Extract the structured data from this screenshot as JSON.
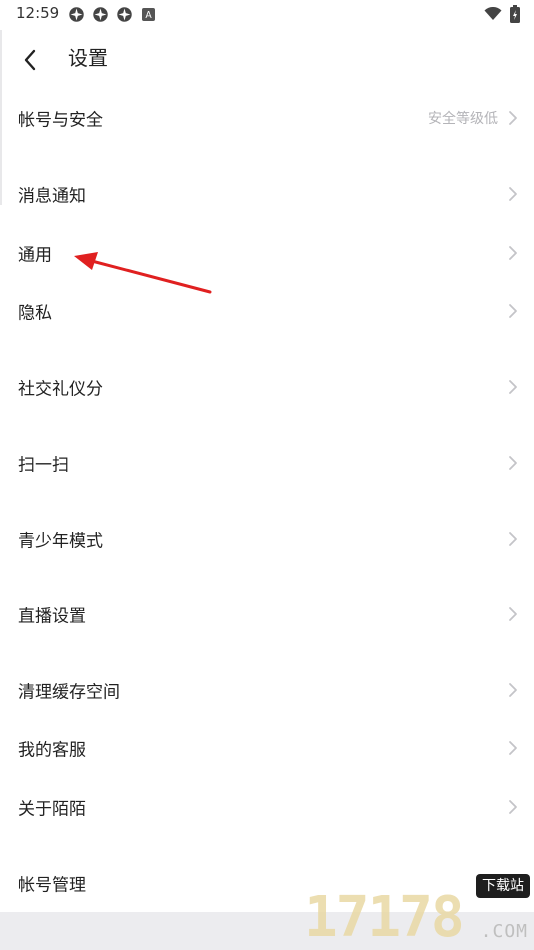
{
  "status_bar": {
    "time": "12:59",
    "icons": [
      "notification-icon-1",
      "notification-icon-2",
      "notification-icon-3",
      "a-icon",
      "wifi-icon",
      "battery-icon"
    ]
  },
  "header": {
    "title": "设置",
    "back_icon": "back-arrow-icon"
  },
  "settings": {
    "items": [
      {
        "label": "帐号与安全",
        "value": "安全等级低"
      },
      {
        "label": "消息通知"
      },
      {
        "label": "通用"
      },
      {
        "label": "隐私"
      },
      {
        "label": "社交礼仪分"
      },
      {
        "label": "扫一扫"
      },
      {
        "label": "青少年模式"
      },
      {
        "label": "直播设置"
      },
      {
        "label": "清理缓存空间"
      },
      {
        "label": "我的客服"
      },
      {
        "label": "关于陌陌"
      },
      {
        "label": "帐号管理"
      }
    ]
  },
  "watermark": {
    "number": "17178",
    "badge": "下载站",
    "suffix": ".COM"
  },
  "colors": {
    "annotation_arrow": "#e02020",
    "bottom_band": "#ececef"
  }
}
